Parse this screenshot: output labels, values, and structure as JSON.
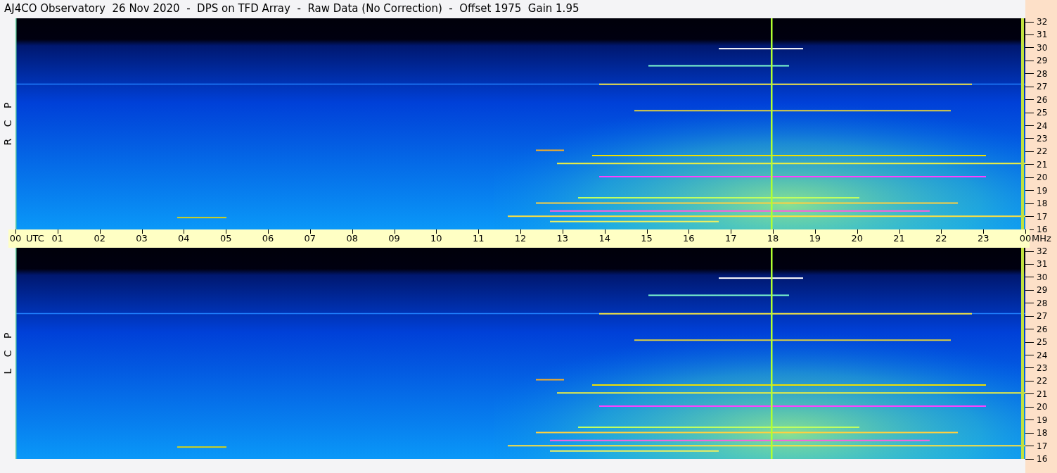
{
  "title": "AJ4CO Observatory  26 Nov 2020  -  DPS on TFD Array  -  Raw Data (No Correction)  -  Offset 1975  Gain 1.95",
  "panels": [
    {
      "channel_label": "R C P",
      "frequency_ticks": [
        "32",
        "31",
        "30",
        "29",
        "28",
        "27",
        "26",
        "25",
        "24",
        "23",
        "22",
        "21",
        "20",
        "19",
        "18",
        "17",
        "16"
      ]
    },
    {
      "channel_label": "L C P",
      "frequency_ticks": [
        "32",
        "31",
        "30",
        "29",
        "28",
        "27",
        "26",
        "25",
        "24",
        "23",
        "22",
        "21",
        "20",
        "19",
        "18",
        "17",
        "16"
      ]
    }
  ],
  "time_axis": {
    "ticks": [
      "00",
      "01",
      "02",
      "03",
      "04",
      "05",
      "06",
      "07",
      "08",
      "09",
      "10",
      "11",
      "12",
      "13",
      "14",
      "15",
      "16",
      "17",
      "18",
      "19",
      "20",
      "21",
      "22",
      "23",
      "00"
    ],
    "time_unit": "UTC",
    "frequency_unit": "MHz"
  }
}
